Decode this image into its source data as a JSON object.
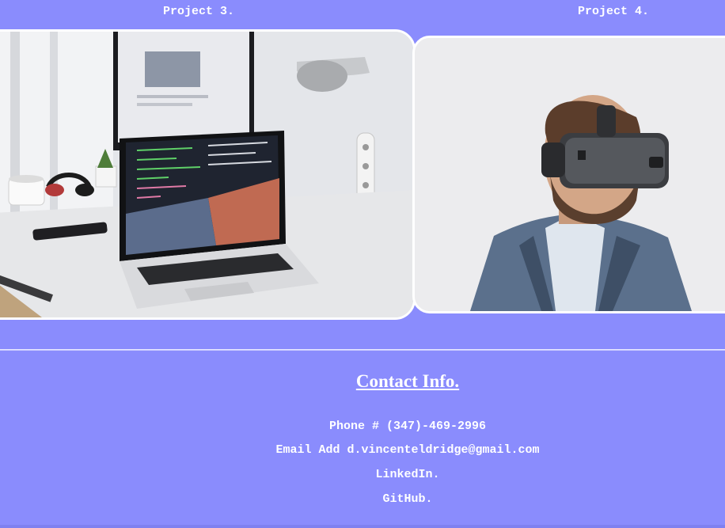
{
  "projects": [
    {
      "title": "Project 3.",
      "image": "laptop-desk-photo"
    },
    {
      "title": "Project 4.",
      "image": "vr-headset-man-photo"
    }
  ],
  "contact": {
    "heading": "Contact Info.",
    "phone": "Phone # (347)-469-2996",
    "email": "Email Add d.vincenteldridge@gmail.com",
    "linkedin": "LinkedIn.",
    "github": "GitHub."
  },
  "colors": {
    "background": "#8a8cfd",
    "text": "#ffffff",
    "card_border": "#ffffff"
  }
}
